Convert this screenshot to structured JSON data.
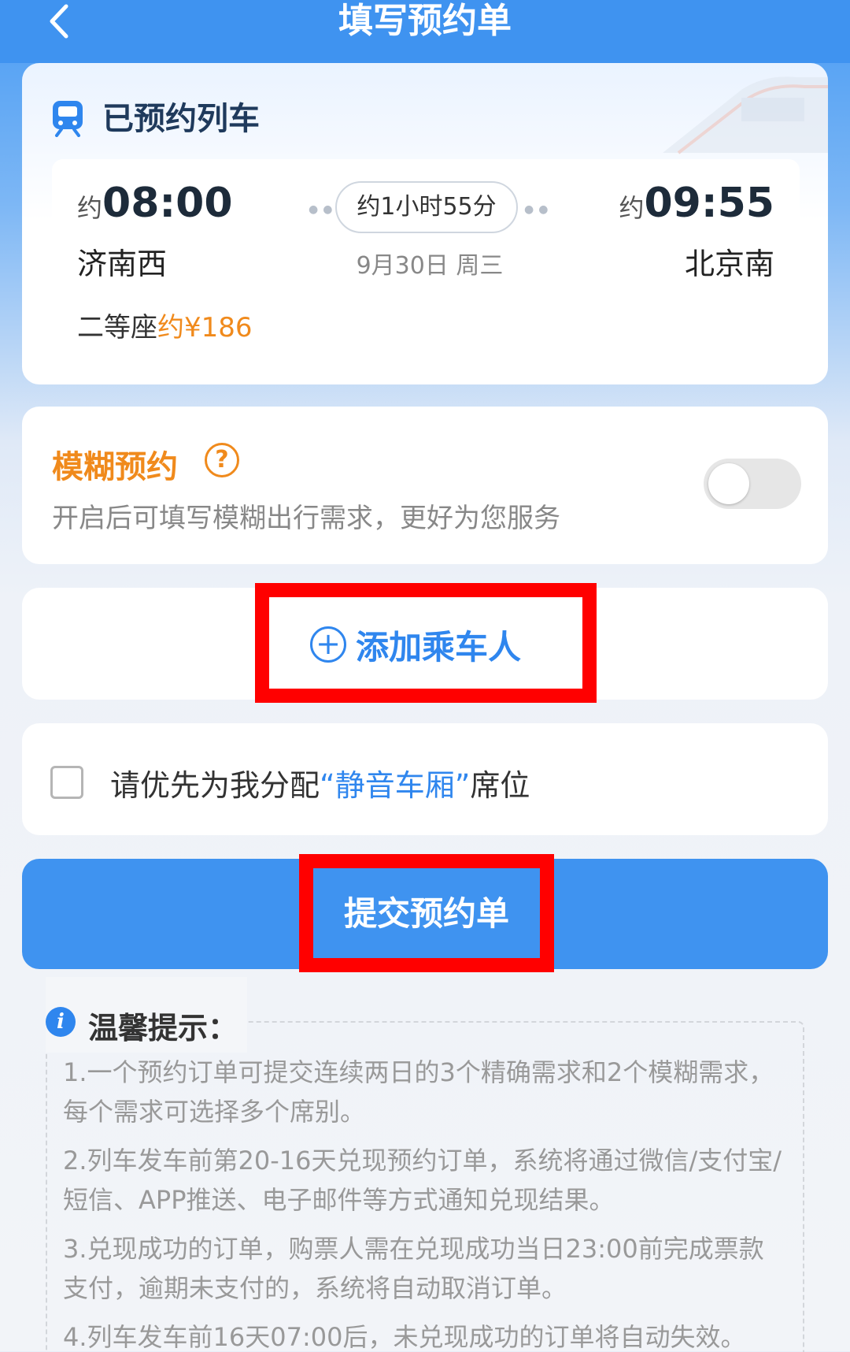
{
  "header": {
    "title": "填写预约单"
  },
  "train": {
    "section_title": "已预约列车",
    "dep_approx": "约",
    "dep_time": "08:00",
    "arr_approx": "约",
    "arr_time": "09:55",
    "duration": "约1小时55分",
    "dep_station": "济南西",
    "arr_station": "北京南",
    "date": "9月30日 周三",
    "seat_class": "二等座",
    "price": "约¥186"
  },
  "fuzzy": {
    "title": "模糊预约",
    "help_glyph": "?",
    "desc": "开启后可填写模糊出行需求，更好为您服务",
    "toggle_on": false
  },
  "add_passenger": {
    "label": "添加乘车人",
    "icon": "+"
  },
  "quiet_car": {
    "prefix": "请优先为我分配",
    "highlight": "“静音车厢”",
    "suffix": "席位",
    "checked": false
  },
  "submit": {
    "label": "提交预约单"
  },
  "tips": {
    "icon": "i",
    "title": "温馨提示：",
    "items": [
      "1.一个预约订单可提交连续两日的3个精确需求和2个模糊需求，每个需求可选择多个席别。",
      "2.列车发车前第20-16天兑现预约订单，系统将通过微信/支付宝/短信、APP推送、电子邮件等方式通知兑现结果。",
      "3.兑现成功的订单，购票人需在兑现成功当日23:00前完成票款支付，逾期未支付的，系统将自动取消订单。",
      "4.列车发车前16天07:00后，未兑现成功的订单将自动失效。"
    ]
  },
  "colors": {
    "primary": "#3f93f0",
    "accent_orange": "#f08a1c",
    "link_blue": "#2f86ee",
    "highlight_box": "#ff0000"
  }
}
